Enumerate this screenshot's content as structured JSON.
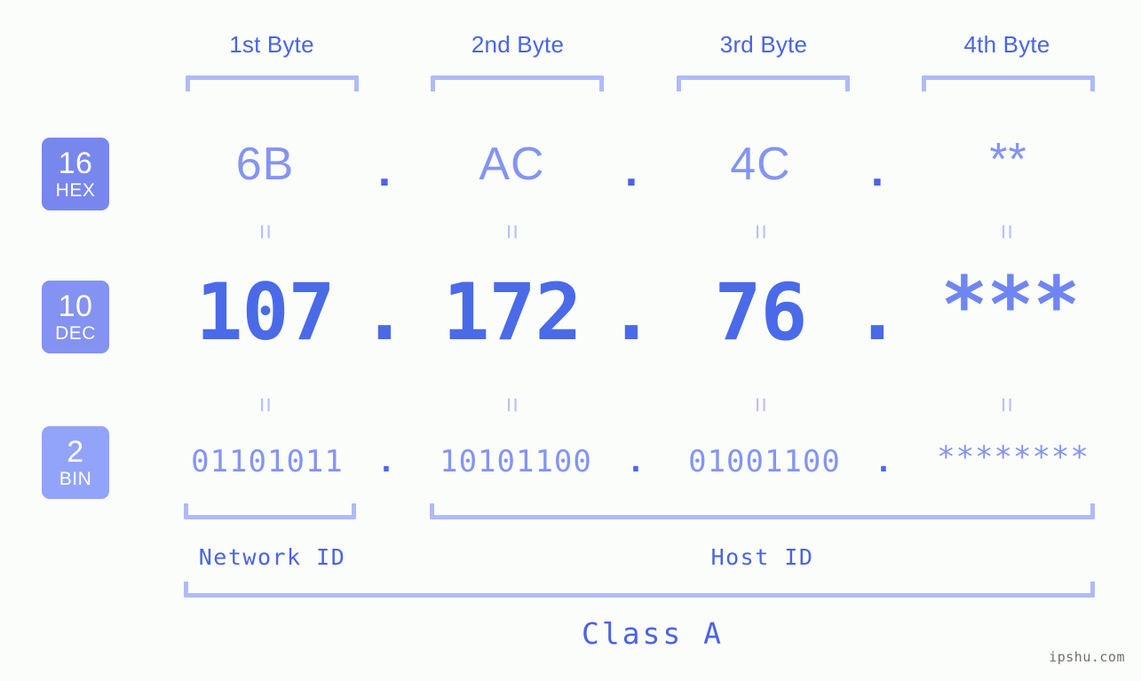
{
  "background": "#fbfdfa",
  "colors": {
    "header_text": "#4a63e7",
    "bracket": "#afbaf8",
    "hex_text": "#8494f4",
    "dec_text": "#4a6ae8",
    "bin_text": "#8494f4",
    "badge_hex": "#7787ee",
    "badge_dec": "#8492f2",
    "badge_bin": "#92a4fa",
    "equals": "#b7c1f7",
    "watermark": "#6f6f6f"
  },
  "byte_headers": [
    {
      "label": "1st Byte"
    },
    {
      "label": "2nd Byte"
    },
    {
      "label": "3rd Byte"
    },
    {
      "label": "4th Byte"
    }
  ],
  "bases": [
    {
      "num": "16",
      "abbr": "HEX"
    },
    {
      "num": "10",
      "abbr": "DEC"
    },
    {
      "num": "2",
      "abbr": "BIN"
    }
  ],
  "rows": {
    "hex": {
      "base_num": "16",
      "base_abbr": "HEX",
      "values": [
        "6B",
        "AC",
        "4C",
        "**"
      ],
      "separator": "."
    },
    "dec": {
      "base_num": "10",
      "base_abbr": "DEC",
      "values": [
        "107",
        "172",
        "76",
        "***"
      ],
      "separator": "."
    },
    "bin": {
      "base_num": "2",
      "base_abbr": "BIN",
      "values": [
        "01101011",
        "10101100",
        "01001100",
        "********"
      ],
      "separator": "."
    }
  },
  "equals_glyph": "=",
  "captions": {
    "network_id": "Network ID",
    "host_id": "Host ID",
    "class": "Class A"
  },
  "watermark": "ipshu.com"
}
